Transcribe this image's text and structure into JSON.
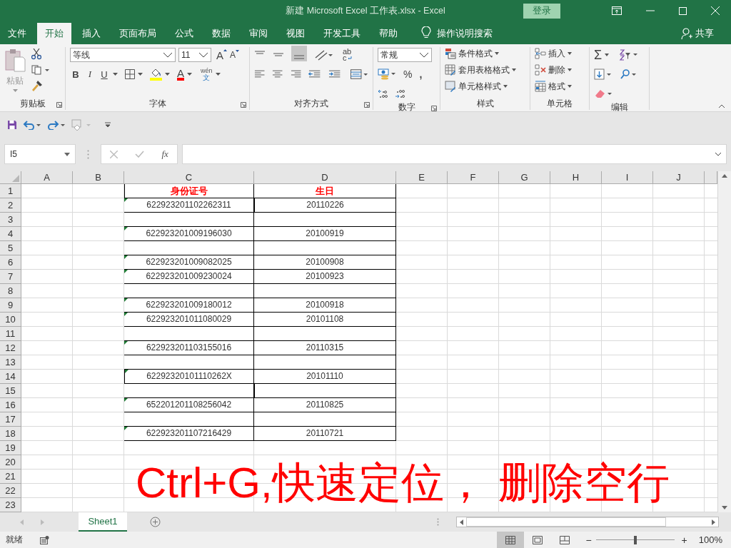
{
  "window": {
    "title": "新建 Microsoft Excel 工作表.xlsx  -  Excel",
    "sign_in": "登录"
  },
  "tabs": [
    {
      "label": "文件",
      "selected": false
    },
    {
      "label": "开始",
      "selected": true
    },
    {
      "label": "插入",
      "selected": false
    },
    {
      "label": "页面布局",
      "selected": false
    },
    {
      "label": "公式",
      "selected": false
    },
    {
      "label": "数据",
      "selected": false
    },
    {
      "label": "审阅",
      "selected": false
    },
    {
      "label": "视图",
      "selected": false
    },
    {
      "label": "开发工具",
      "selected": false
    },
    {
      "label": "帮助",
      "selected": false
    }
  ],
  "tell_me": "操作说明搜索",
  "share": "共享",
  "ribbon": {
    "clipboard": {
      "paste": "粘贴",
      "label": "剪贴板"
    },
    "font": {
      "font_name": "等线",
      "font_size": "11",
      "grow": "A",
      "shrink": "A",
      "styles": [
        "B",
        "I",
        "U"
      ],
      "font_color": "A",
      "phonetic": [
        "wén",
        "文"
      ],
      "label": "字体"
    },
    "alignment": {
      "label": "对齐方式",
      "wrap": [
        "ab",
        "c"
      ]
    },
    "number": {
      "format": "常规",
      "percent": "%",
      "comma": ",",
      "label": "数字"
    },
    "styles": {
      "items": [
        "条件格式",
        "套用表格格式",
        "单元格样式"
      ],
      "label": "样式"
    },
    "cells": {
      "items": [
        "插入",
        "删除",
        "格式"
      ],
      "label": "单元格"
    },
    "editing": {
      "sum": "Σ",
      "label": "编辑"
    }
  },
  "formula_bar": {
    "name_box": "I5",
    "fx": "fx"
  },
  "columns": [
    "A",
    "B",
    "C",
    "D",
    "E",
    "F",
    "G",
    "H",
    "I",
    "J"
  ],
  "rows": [
    {
      "number": "1",
      "kind": "header",
      "c": "身份证号",
      "d": "生日"
    },
    {
      "number": "2",
      "kind": "data",
      "c": "622923201102262311",
      "d": "20110226"
    },
    {
      "number": "3",
      "kind": "blank"
    },
    {
      "number": "4",
      "kind": "data",
      "c": "622923201009196030",
      "d": "20100919"
    },
    {
      "number": "5",
      "kind": "blank"
    },
    {
      "number": "6",
      "kind": "data",
      "c": "622923201009082025",
      "d": "20100908"
    },
    {
      "number": "7",
      "kind": "data",
      "c": "622923201009230024",
      "d": "20100923"
    },
    {
      "number": "8",
      "kind": "blank"
    },
    {
      "number": "9",
      "kind": "data",
      "c": "622923201009180012",
      "d": "20100918"
    },
    {
      "number": "10",
      "kind": "data",
      "c": "622923201011080029",
      "d": "20101108"
    },
    {
      "number": "11",
      "kind": "blank"
    },
    {
      "number": "12",
      "kind": "data",
      "c": "622923201103155016",
      "d": "20110315"
    },
    {
      "number": "13",
      "kind": "blank"
    },
    {
      "number": "14",
      "kind": "data",
      "c": "62292320101110262X",
      "d": "20101110"
    },
    {
      "number": "15",
      "kind": "blank"
    },
    {
      "number": "16",
      "kind": "data",
      "c": "652201201108256042",
      "d": "20110825"
    },
    {
      "number": "17",
      "kind": "blank"
    },
    {
      "number": "18",
      "kind": "data",
      "c": "622923201107216429",
      "d": "20110721"
    },
    {
      "number": "19",
      "kind": "empty"
    },
    {
      "number": "20",
      "kind": "empty"
    },
    {
      "number": "21",
      "kind": "empty"
    },
    {
      "number": "22",
      "kind": "empty"
    },
    {
      "number": "23",
      "kind": "empty"
    }
  ],
  "caption": "Ctrl+G,快速定位， 删除空行",
  "sheets": [
    {
      "label": "Sheet1",
      "selected": true
    }
  ],
  "status_bar": {
    "status": "就绪",
    "views": [
      {
        "kind": "normal",
        "selected": true
      },
      {
        "kind": "page_layout",
        "selected": false
      },
      {
        "kind": "page_break",
        "selected": false
      }
    ],
    "zoom_out": "−",
    "zoom_in": "+",
    "zoom": {
      "level": 0.5
    },
    "zoom_label": "100%"
  }
}
